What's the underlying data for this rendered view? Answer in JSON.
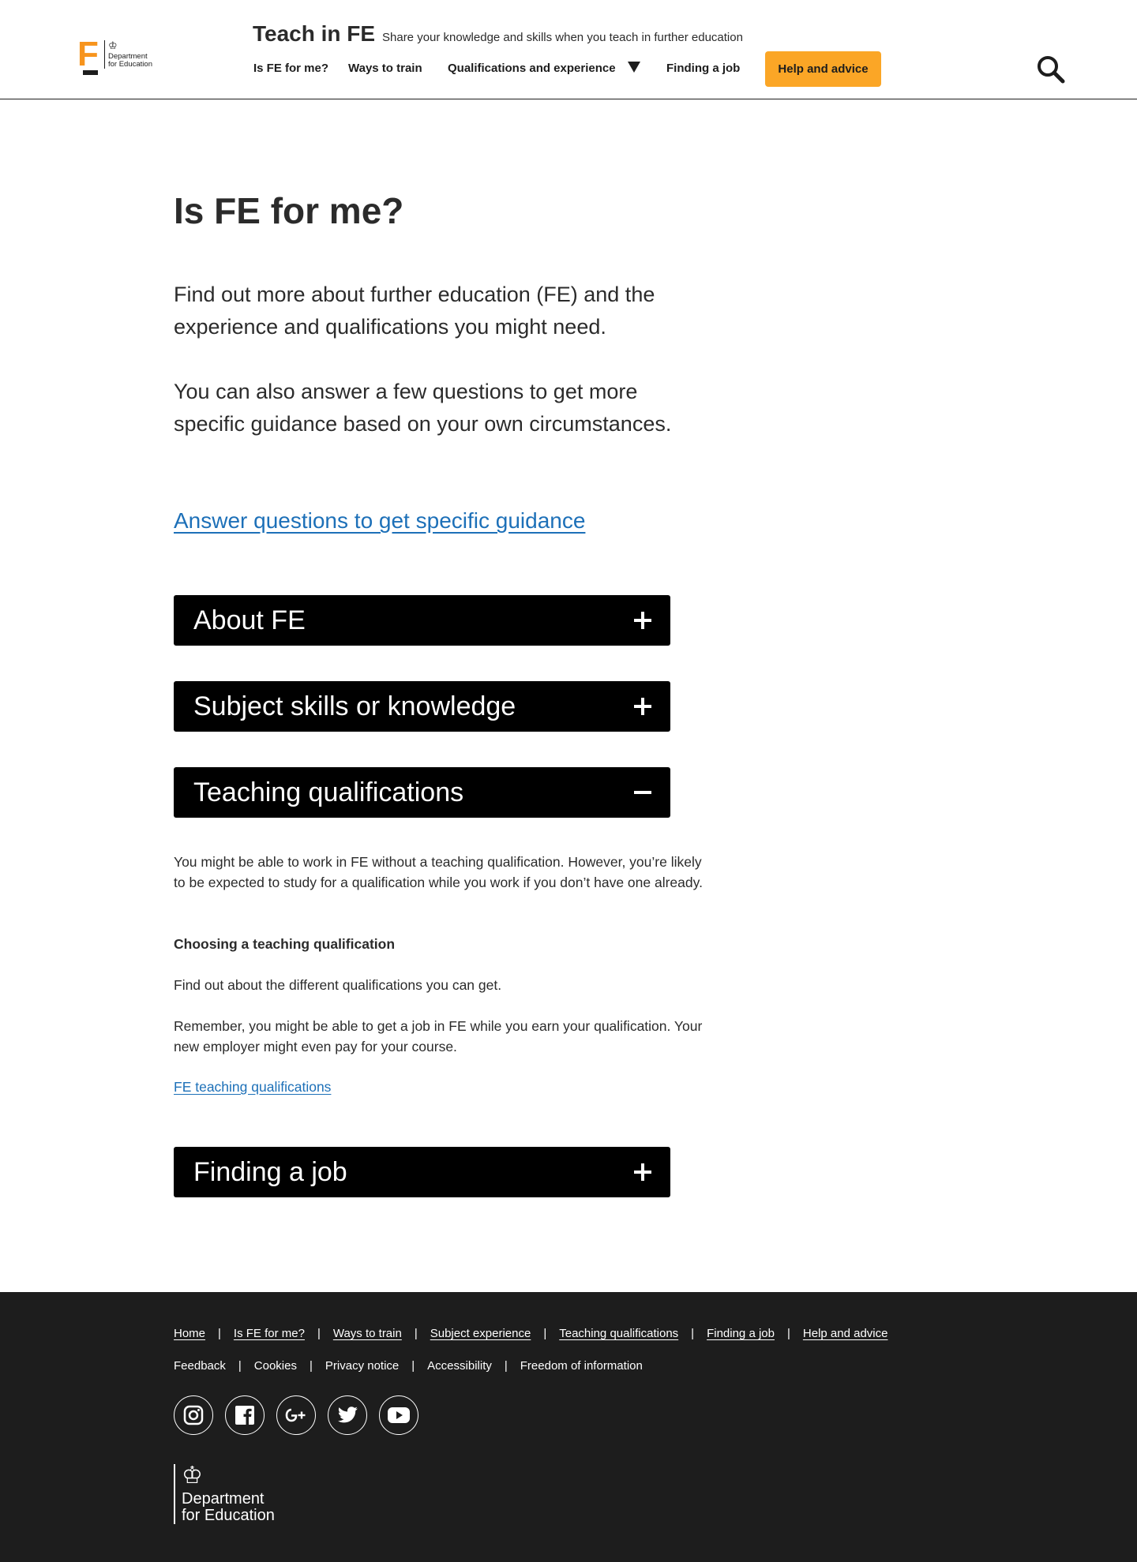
{
  "header": {
    "logo_dept_line1": "Department",
    "logo_dept_line2": "for Education",
    "service_name": "Teach in FE",
    "tagline": "Share your knowledge and skills when you teach in further education",
    "nav": [
      {
        "label": "Is FE for me?"
      },
      {
        "label": "Ways to train"
      },
      {
        "label": "Qualifications and experience"
      },
      {
        "label": "Finding a job"
      }
    ],
    "help_button": "Help and advice",
    "icons": {
      "search": "search-icon",
      "dropdown": "caret-down-icon",
      "crest": "royal-crest-icon"
    }
  },
  "main": {
    "title": "Is FE for me?",
    "lead_1": "Find out more about further education (FE) and the experience and qualifications you might need.",
    "lead_2": "You can also answer a few questions to get more specific guidance based on your own circumstances.",
    "cta_link": "Answer questions to get specific guidance",
    "accordion": [
      {
        "title": "About FE",
        "expanded": false
      },
      {
        "title": "Subject skills or knowledge",
        "expanded": false
      },
      {
        "title": "Teaching qualifications",
        "expanded": true
      },
      {
        "title": "Finding a job",
        "expanded": false
      }
    ],
    "teaching_qualifications": {
      "intro": "You might be able to work in FE without a teaching qualification. However, you’re likely to be expected to study for a qualification while you work if you don’t have one already.",
      "subhead": "Choosing a teaching qualification",
      "p1": "Find out about the different qualifications you can get.",
      "p2": "Remember, you might be able to get a job in FE while you earn your qualification. Your new employer might even pay for your course.",
      "link": "FE teaching qualifications"
    }
  },
  "footer": {
    "links_primary": [
      "Home",
      "Is FE for me?",
      "Ways to train",
      "Subject experience",
      "Teaching qualifications",
      "Finding a job",
      "Help and advice"
    ],
    "links_secondary": [
      "Feedback",
      "Cookies",
      "Privacy notice",
      "Accessibility",
      "Freedom of information"
    ],
    "separator": "|",
    "socials": [
      "instagram-icon",
      "facebook-icon",
      "google-plus-icon",
      "twitter-icon",
      "youtube-icon"
    ],
    "logo_line1": "Department",
    "logo_line2": "for Education"
  },
  "colors": {
    "accent_orange": "#fba626",
    "logo_orange": "#f7941d",
    "link_blue": "#1d70b8",
    "accordion_bg": "#000000",
    "footer_bg": "#1d1d1d",
    "text": "#2b2b2b"
  }
}
